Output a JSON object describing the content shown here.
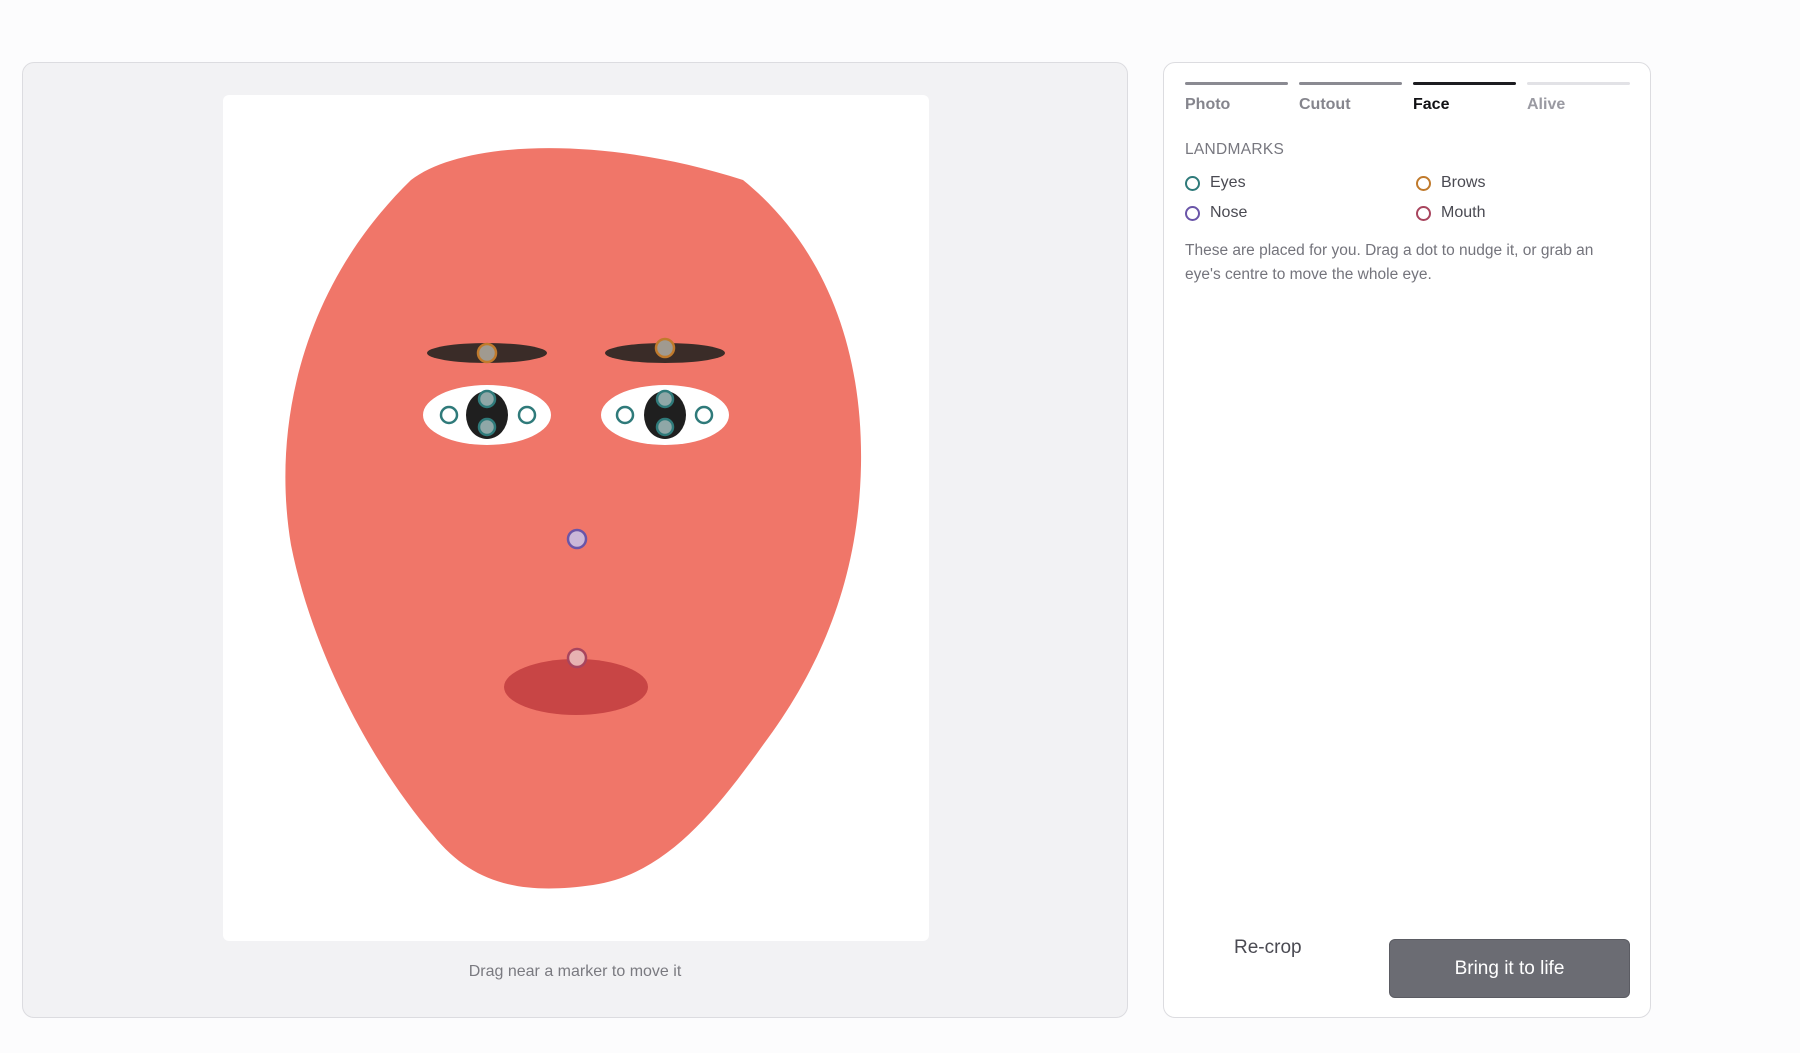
{
  "canvas": {
    "hint": "Drag near a marker to move it"
  },
  "steps": [
    {
      "label": "Photo",
      "state": "done"
    },
    {
      "label": "Cutout",
      "state": "done"
    },
    {
      "label": "Face",
      "state": "active"
    },
    {
      "label": "Alive",
      "state": "pending"
    }
  ],
  "landmarks": {
    "title": "LANDMARKS",
    "items": [
      {
        "label": "Eyes",
        "color": "#2f7a7a"
      },
      {
        "label": "Brows",
        "color": "#c07a2c"
      },
      {
        "label": "Nose",
        "color": "#6a55a8"
      },
      {
        "label": "Mouth",
        "color": "#a8455e"
      }
    ],
    "description": "These are placed for you. Drag a dot to nudge it, or grab an eye's centre to move the whole eye."
  },
  "actions": {
    "recrop_label": "Re-crop",
    "primary_label": "Bring it to life"
  },
  "colors": {
    "face": "#f07669",
    "mouth": "#c84545",
    "brow": "#3a2c28",
    "pupil": "#1f1f1f"
  }
}
